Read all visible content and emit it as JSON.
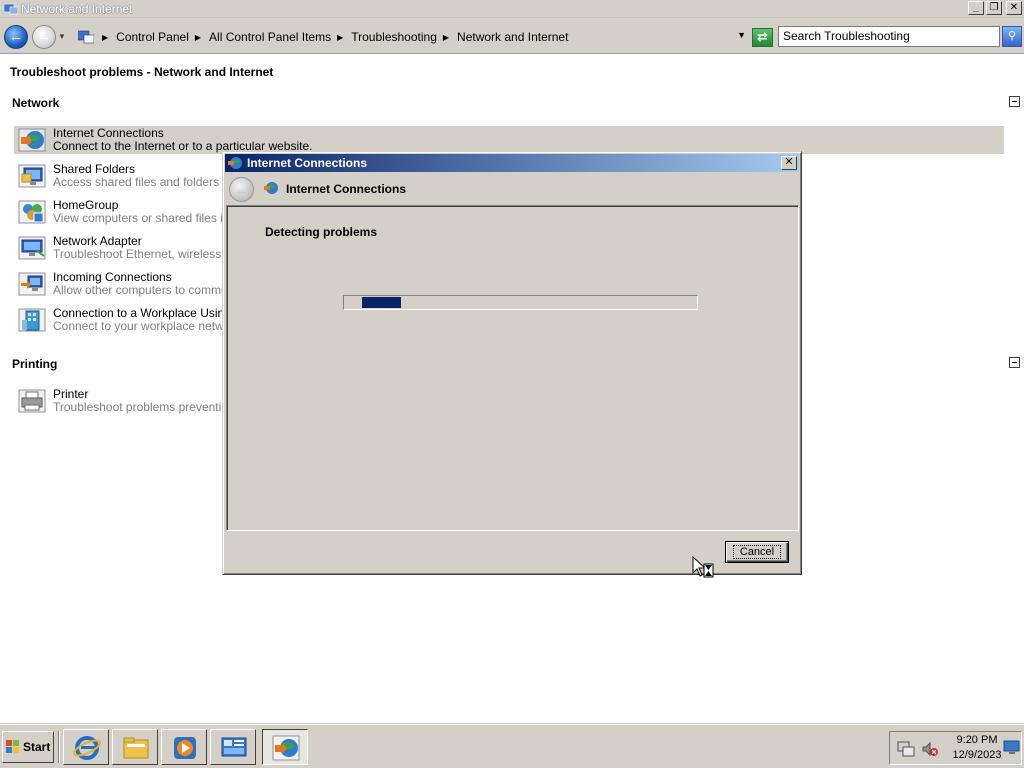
{
  "window": {
    "title": "Network and Internet",
    "buttons": [
      "minimize",
      "restore",
      "close"
    ]
  },
  "address": {
    "breadcrumbs": [
      "Control Panel",
      "All Control Panel Items",
      "Troubleshooting",
      "Network and Internet"
    ],
    "search_placeholder": "Search Troubleshooting"
  },
  "main": {
    "page_title": "Troubleshoot problems - Network and Internet",
    "sections": {
      "network": {
        "title": "Network",
        "items": [
          {
            "name": "Internet Connections",
            "desc": "Connect to the Internet or to a particular website.",
            "icon": "internet-globe-icon"
          },
          {
            "name": "Shared Folders",
            "desc": "Access shared files and folders on other computers.",
            "icon": "shared-folders-icon"
          },
          {
            "name": "HomeGroup",
            "desc": "View computers or shared files in a homegroup.",
            "icon": "homegroup-icon"
          },
          {
            "name": "Network Adapter",
            "desc": "Troubleshoot Ethernet, wireless, or other network adapters.",
            "icon": "network-adapter-icon"
          },
          {
            "name": "Incoming Connections",
            "desc": "Allow other computers to communicate with your computer.",
            "icon": "incoming-connections-icon"
          },
          {
            "name": "Connection to a Workplace Using DirectAccess",
            "desc": "Connect to your workplace network over the Internet.",
            "icon": "workplace-icon"
          }
        ]
      },
      "printing": {
        "title": "Printing",
        "items": [
          {
            "name": "Printer",
            "desc": "Troubleshoot problems preventing printing from completing.",
            "icon": "printer-icon"
          }
        ]
      }
    }
  },
  "dialog": {
    "title": "Internet Connections",
    "header_title": "Internet Connections",
    "status": "Detecting problems",
    "progress": 0.11,
    "cancel_label": "Cancel"
  },
  "taskbar": {
    "start_label": "Start",
    "pinned": [
      "internet-explorer-icon",
      "windows-explorer-icon",
      "media-player-icon",
      "server-manager-icon",
      "troubleshooting-icon"
    ],
    "clock_time": "9:20 PM",
    "clock_date": "12/9/2023"
  },
  "colors": {
    "window_bg": "#d4d0c8",
    "dialog_title_start": "#0a246a",
    "dialog_title_end": "#a6caf0",
    "progress_fill": "#0a246a",
    "selected_row": "#d4d0c8"
  }
}
